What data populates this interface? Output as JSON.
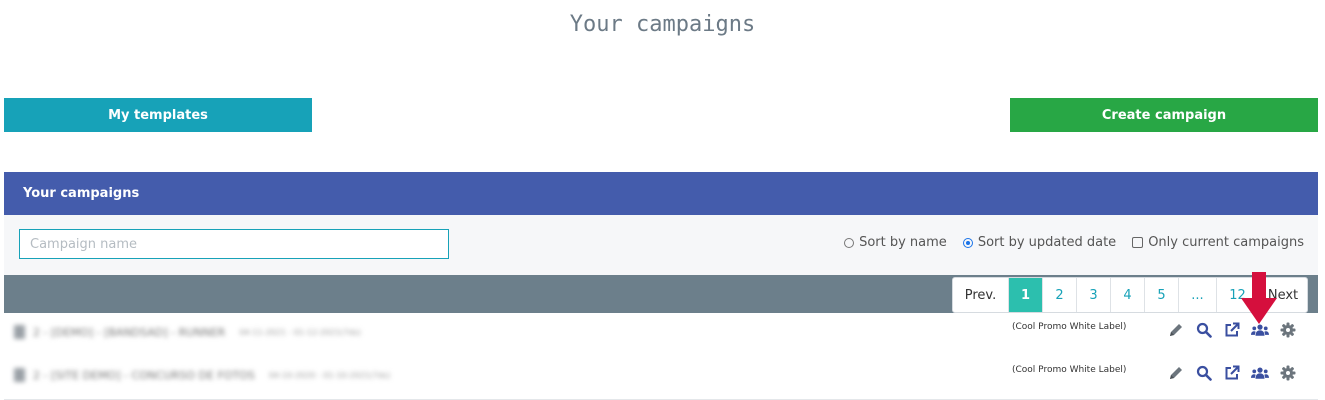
{
  "page": {
    "heading": "Your campaigns"
  },
  "buttons": {
    "templates": "My templates",
    "create": "Create campaign"
  },
  "panel": {
    "title": "Your campaigns"
  },
  "filters": {
    "search_placeholder": "Campaign name",
    "sort_name": "Sort by name",
    "sort_updated": "Sort by updated date",
    "sort_selected": "updated",
    "only_current": "Only current campaigns",
    "only_current_checked": false
  },
  "pagination": {
    "prev": "Prev.",
    "pages": [
      "1",
      "2",
      "3",
      "4",
      "5",
      "...",
      "12"
    ],
    "active": "1",
    "next": "Next"
  },
  "campaigns": [
    {
      "name": "2 - [DEMO] - [BANDSAD] - RUNNER",
      "date": "04-11-2021 - 01-12-2021(7ds)",
      "client": "(Cool Promo White Label)"
    },
    {
      "name": "2 - [SITE DEMO] - CONCURSO DE FOTOS",
      "date": "04-10-2020 - 01-10-2021(7ds)",
      "client": "(Cool Promo White Label)"
    }
  ],
  "row_actions": [
    "pencil-icon",
    "search-icon",
    "external-link-icon",
    "users-icon",
    "gear-icon"
  ],
  "colors": {
    "teal": "#17a2b8",
    "green": "#28a745",
    "header_blue": "#445cac",
    "pagebar": "#6c7f8b",
    "active_page": "#2cbfae",
    "icon_blue": "#3a4fa0",
    "icon_gray": "#6c757d",
    "annotation_red": "#d50f3d"
  }
}
